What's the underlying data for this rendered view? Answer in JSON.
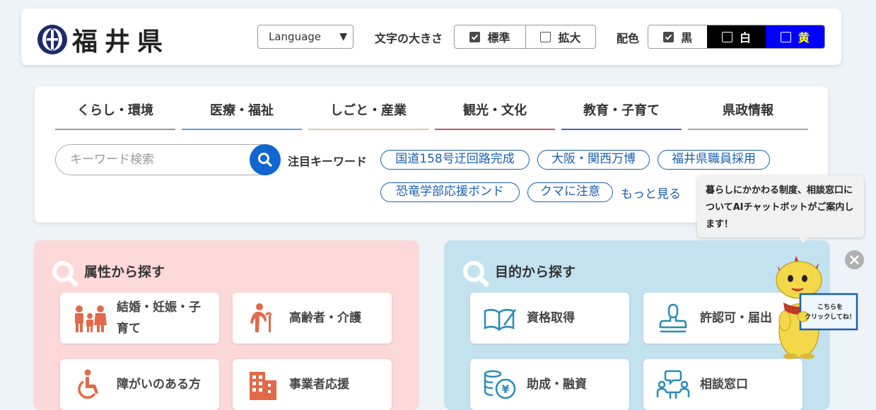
{
  "header": {
    "logo_text": "福井県",
    "language_label": "Language",
    "font_size_label": "文字の大きさ",
    "font_size_options": [
      "標準",
      "拡大"
    ],
    "color_label": "配色",
    "color_options": [
      "黒",
      "白",
      "黄"
    ]
  },
  "nav": {
    "tabs": [
      {
        "label": "くらし・環境",
        "color": "#999999"
      },
      {
        "label": "医療・福祉",
        "color": "#5aa0d8"
      },
      {
        "label": "しごと・産業",
        "color": "#d8cbb5"
      },
      {
        "label": "観光・文化",
        "color": "#c0546a"
      },
      {
        "label": "教育・子育て",
        "color": "#5a5fb0"
      },
      {
        "label": "県政情報",
        "color": "#a8a8a8"
      }
    ],
    "search_placeholder": "キーワード検索",
    "keywords_label": "注目キーワード",
    "keywords": [
      "国道158号迂回路完成",
      "大阪・関西万博",
      "福井県職員採用",
      "恐竜学部応援ボンド",
      "クマに注意"
    ],
    "more_label": "もっと見る"
  },
  "attribute_panel": {
    "title": "属性から探す",
    "items": [
      {
        "label": "結婚・妊娠・子育て",
        "icon": "family-icon"
      },
      {
        "label": "高齢者・介護",
        "icon": "elderly-icon"
      },
      {
        "label": "障がいのある方",
        "icon": "wheelchair-icon"
      },
      {
        "label": "事業者応援",
        "icon": "building-icon"
      }
    ]
  },
  "purpose_panel": {
    "title": "目的から探す",
    "items": [
      {
        "label": "資格取得",
        "icon": "book-pen-icon"
      },
      {
        "label": "許認可・届出",
        "icon": "stamp-icon"
      },
      {
        "label": "助成・融資",
        "icon": "coins-yen-icon"
      },
      {
        "label": "相談窓口",
        "icon": "consultation-icon"
      }
    ]
  },
  "chat": {
    "bubble_text": "暮らしにかかわる制度、相談窓口についてAIチャットボットがご案内します！",
    "sign_line1": "こちらを",
    "sign_line2": "クリックしてね！"
  },
  "colors": {
    "attr_panel_bg": "#fdd8d8",
    "purpose_panel_bg": "#c3e2ef",
    "accent_blue": "#1266d0",
    "keyword_blue": "#1a5fb0"
  }
}
